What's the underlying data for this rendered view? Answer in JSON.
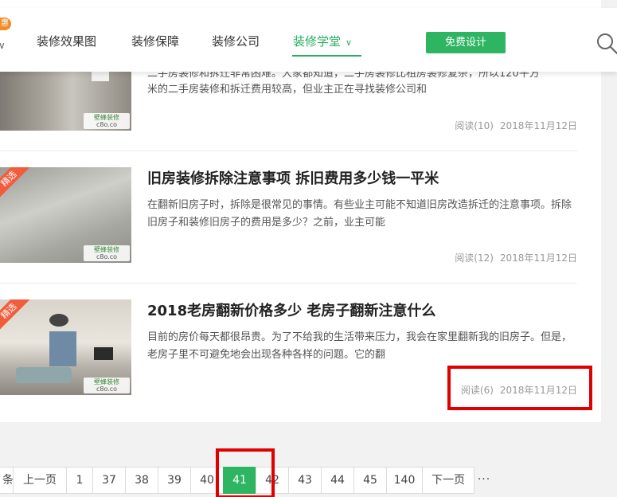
{
  "header": {
    "hot_badge": "惠",
    "nav": [
      {
        "label": "装修效果图"
      },
      {
        "label": "装修保障"
      },
      {
        "label": "装修公司"
      },
      {
        "label": "装修学堂"
      }
    ],
    "free_design_label": "免费设计"
  },
  "articles": [
    {
      "title": "",
      "summary_partial_top": "二手房装修和拆迁非常困难。大家都知道，二手房装修比租房装修复杂，所以120平方",
      "summary": "米的二手房装修和拆迁费用较高，但业主正在寻找装修公司和",
      "views": "阅读(10)",
      "date": "2018年11月12日",
      "watermark": "壁蜂装修",
      "watermark_site": "c8o.co"
    },
    {
      "title": "旧房装修拆除注意事项 拆旧费用多少钱一平米",
      "summary": "在翻新旧房子时，拆除是很常见的事情。有些业主可能不知道旧房改造拆迁的注意事项。拆除旧房子和装修旧房子的费用是多少？之前，业主可能",
      "views": "阅读(12)",
      "date": "2018年11月12日",
      "ribbon": "精选",
      "watermark": "壁蜂装修",
      "watermark_site": "c8o.co"
    },
    {
      "title": "2018老房翻新价格多少 老房子翻新注意什么",
      "summary": "目前的房价每天都很昂贵。为了不给我的生活带来压力，我会在家里翻新我的旧房子。但是，老房子里不可避免地会出现各种各样的问题。它的翻",
      "views": "阅读(6)",
      "date": "2018年11月12日",
      "ribbon": "精选",
      "watermark": "壁蜂装修",
      "watermark_site": "c8o.co"
    }
  ],
  "pagination": {
    "items": [
      "条",
      "上一页",
      "1",
      "37",
      "38",
      "39",
      "40",
      "41",
      "42",
      "43",
      "44",
      "45",
      "140",
      "下一页",
      "···"
    ],
    "active": "41"
  },
  "colors": {
    "accent_green": "#2db561",
    "highlight_red": "#e00000",
    "ribbon_orange": "#f25c3d"
  }
}
